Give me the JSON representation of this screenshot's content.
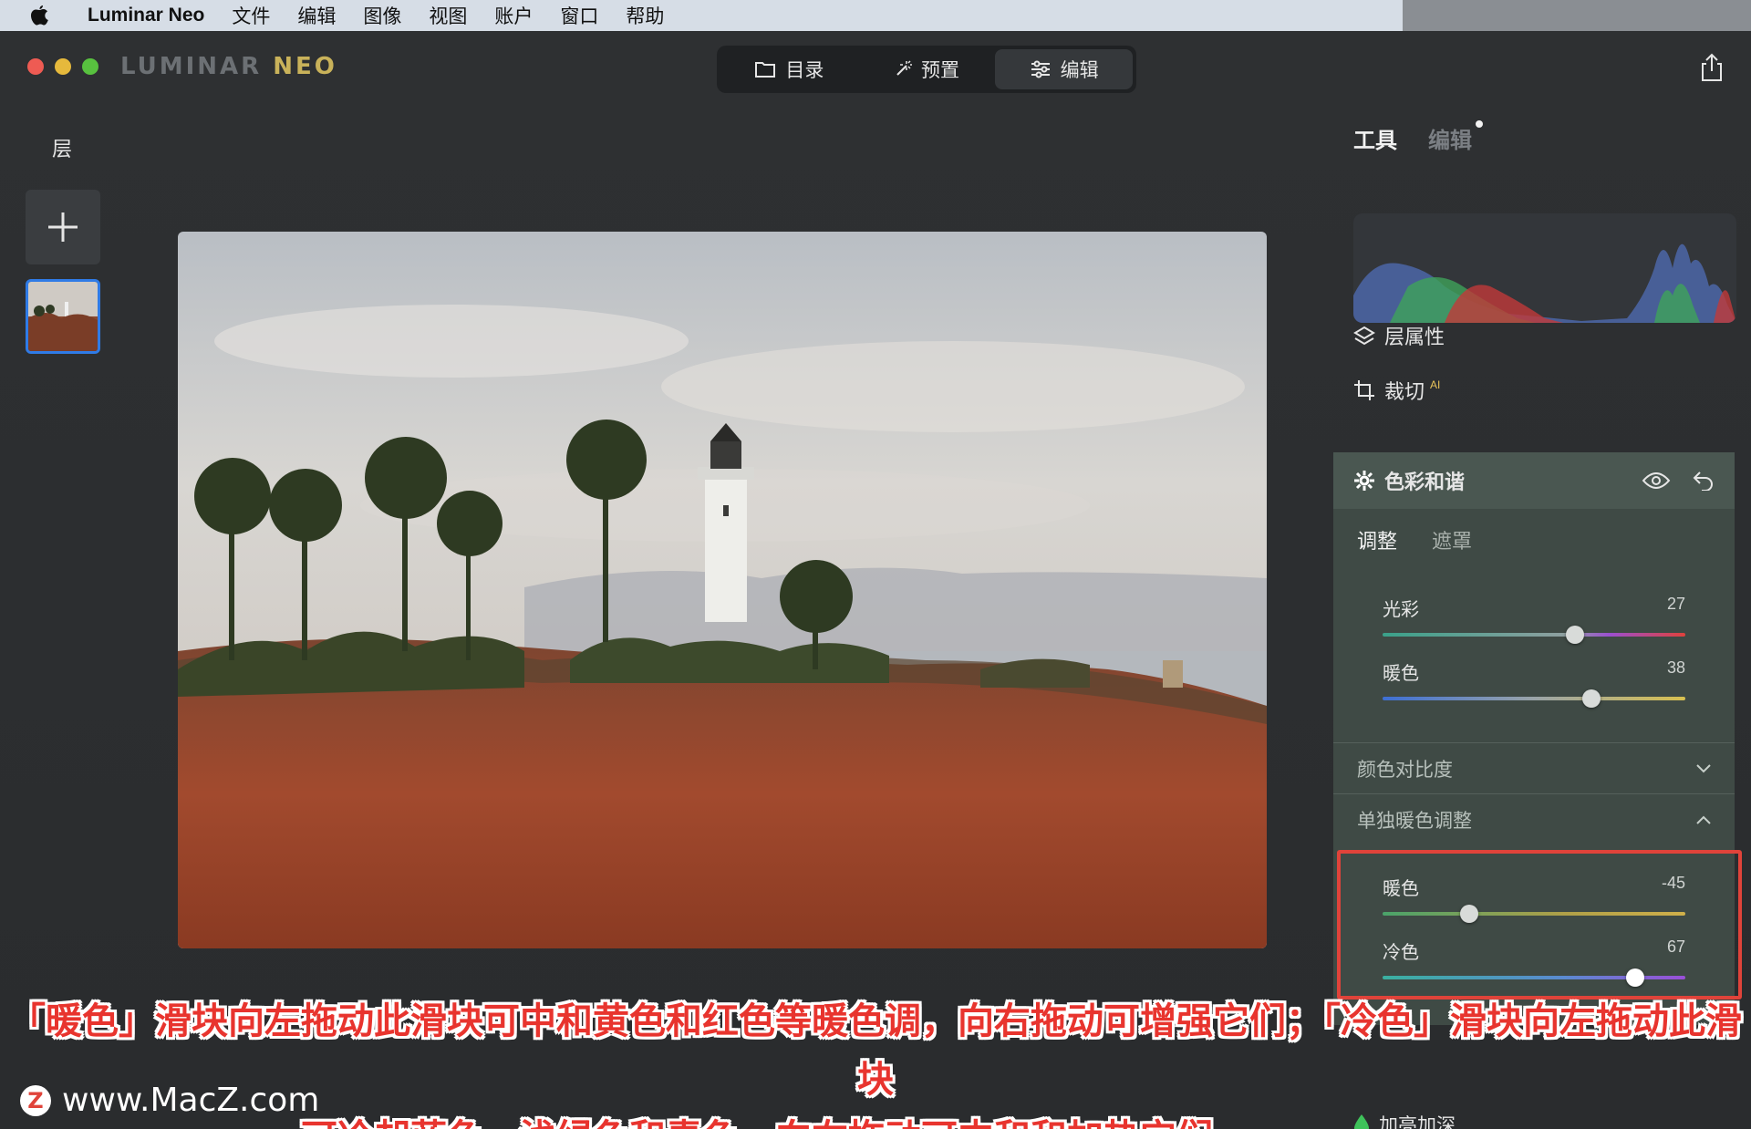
{
  "menubar": {
    "app_name": "Luminar Neo",
    "items": [
      "文件",
      "编辑",
      "图像",
      "视图",
      "账户",
      "窗口",
      "帮助"
    ]
  },
  "brand": {
    "part1": "LUMINAR",
    "part2": "NEO"
  },
  "modes": [
    {
      "label": "目录",
      "icon": "folder-icon"
    },
    {
      "label": "预置",
      "icon": "magic-wand-icon"
    },
    {
      "label": "编辑",
      "icon": "sliders-icon",
      "active": true
    }
  ],
  "layers": {
    "title": "层"
  },
  "right_panel": {
    "tab_tools": "工具",
    "tab_edits": "编辑",
    "layer_props": "层属性",
    "crop": "裁切",
    "crop_badge": "AI",
    "harmony": {
      "title": "色彩和谐",
      "subtab_adjust": "调整",
      "subtab_mask": "遮罩",
      "sliders": [
        {
          "label": "光彩",
          "value": "27"
        },
        {
          "label": "暖色",
          "value": "38"
        }
      ],
      "section_contrast": "颜色对比度",
      "section_warm": "单独暖色调整",
      "warm_sliders": [
        {
          "label": "暖色",
          "value": "-45"
        },
        {
          "label": "冷色",
          "value": "67"
        }
      ]
    },
    "dodge_burn": "加亮加深"
  },
  "caption": {
    "line1": "「暖色」滑块向左拖动此滑块可中和黄色和红色等暖色调，向右拖动可增强它们；「冷色」滑块向左拖动此滑块",
    "line2": "可冷却蓝色、浅绿色和青色，向右拖动可中和和加热它们"
  },
  "watermark": {
    "logo": "Z",
    "text": "www.MacZ.com"
  },
  "colors": {
    "accent_blue": "#2f7be6",
    "highlight_red": "#e0433a",
    "panel_green": "#3f4a45"
  }
}
